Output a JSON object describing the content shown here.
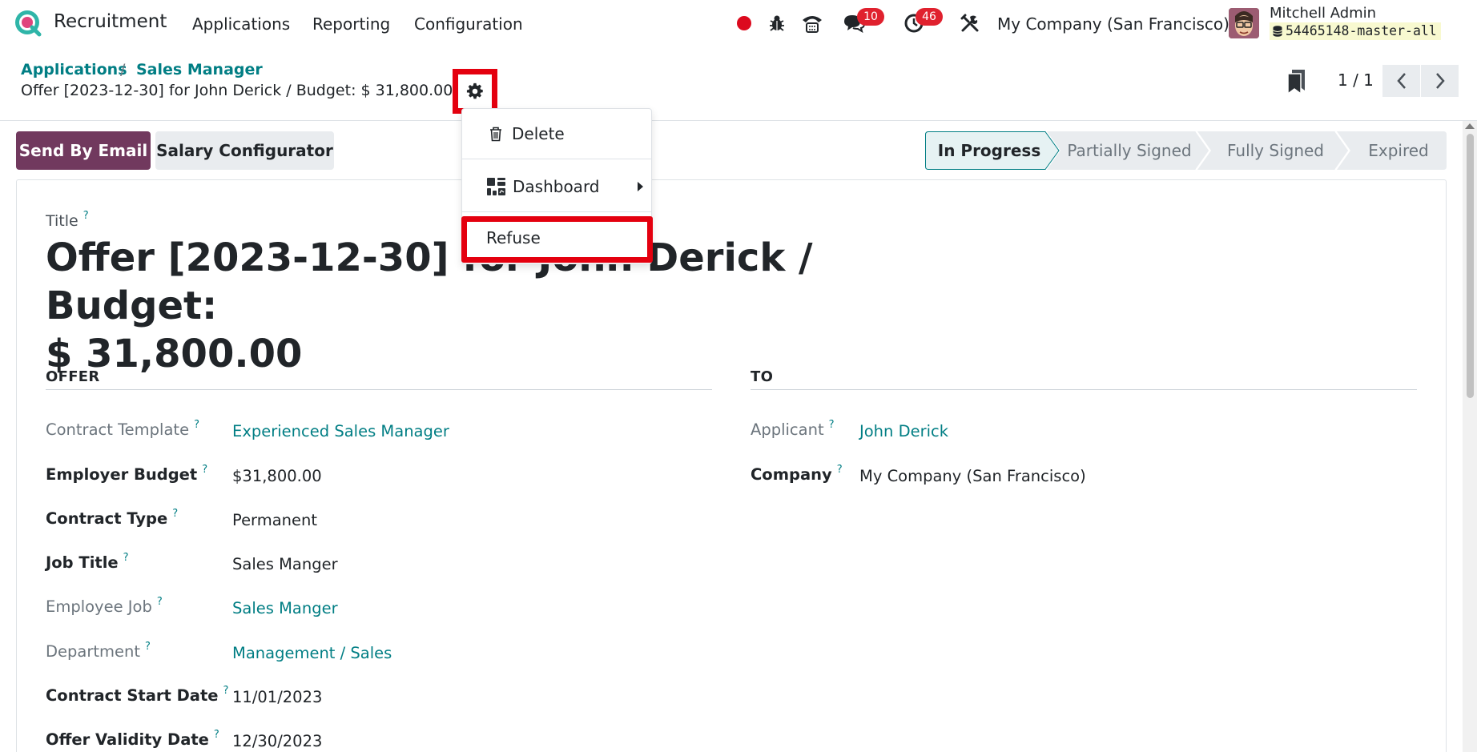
{
  "navbar": {
    "app_name": "Recruitment",
    "menus": [
      "Applications",
      "Reporting",
      "Configuration"
    ],
    "messages_count": "10",
    "activities_count": "46",
    "company": "My Company (San Francisco)",
    "user_name": "Mitchell Admin",
    "database": "54465148-master-all"
  },
  "breadcrumb": {
    "items": [
      "Applications",
      "Sales Manager"
    ],
    "separator": "/",
    "current": "Offer [2023-12-30] for John Derick / Budget: $ 31,800.00"
  },
  "pager": {
    "value": "1 / 1"
  },
  "actions": {
    "send_by_email": "Send By Email",
    "salary_configurator": "Salary Configurator"
  },
  "statusbar": {
    "stages": [
      "In Progress",
      "Partially Signed",
      "Fully Signed",
      "Expired"
    ],
    "active": "In Progress"
  },
  "form": {
    "title_label": "Title",
    "title_value_line1": "Offer [2023-12-30] for John Derick / Budget:",
    "title_value_line2": "$ 31,800.00",
    "help_mark": "?",
    "offer_section": "OFFER",
    "to_section": "TO",
    "offer_fields": [
      {
        "label": "Contract Template",
        "value": "Experienced Sales Manager"
      },
      {
        "label": "Employer Budget",
        "value": "$31,800.00"
      },
      {
        "label": "Contract Type",
        "value": "Permanent"
      },
      {
        "label": "Job Title",
        "value": "Sales Manger"
      },
      {
        "label": "Employee Job",
        "value": "Sales Manger"
      },
      {
        "label": "Department",
        "value": "Management / Sales"
      },
      {
        "label": "Contract Start Date",
        "value": "11/01/2023"
      },
      {
        "label": "Offer Validity Date",
        "value": "12/30/2023"
      }
    ],
    "to_fields": [
      {
        "label": "Applicant",
        "value": "John Derick"
      },
      {
        "label": "Company",
        "value": "My Company (San Francisco)"
      }
    ]
  },
  "dropdown": {
    "items": [
      "Delete",
      "Dashboard",
      "Refuse"
    ]
  },
  "colors": {
    "brand_primary": "#71395e",
    "link_teal": "#017e84",
    "badge_red": "#e0212e",
    "annotation_red": "#e4000f",
    "active_stage_bg": "#e6f2f3"
  }
}
